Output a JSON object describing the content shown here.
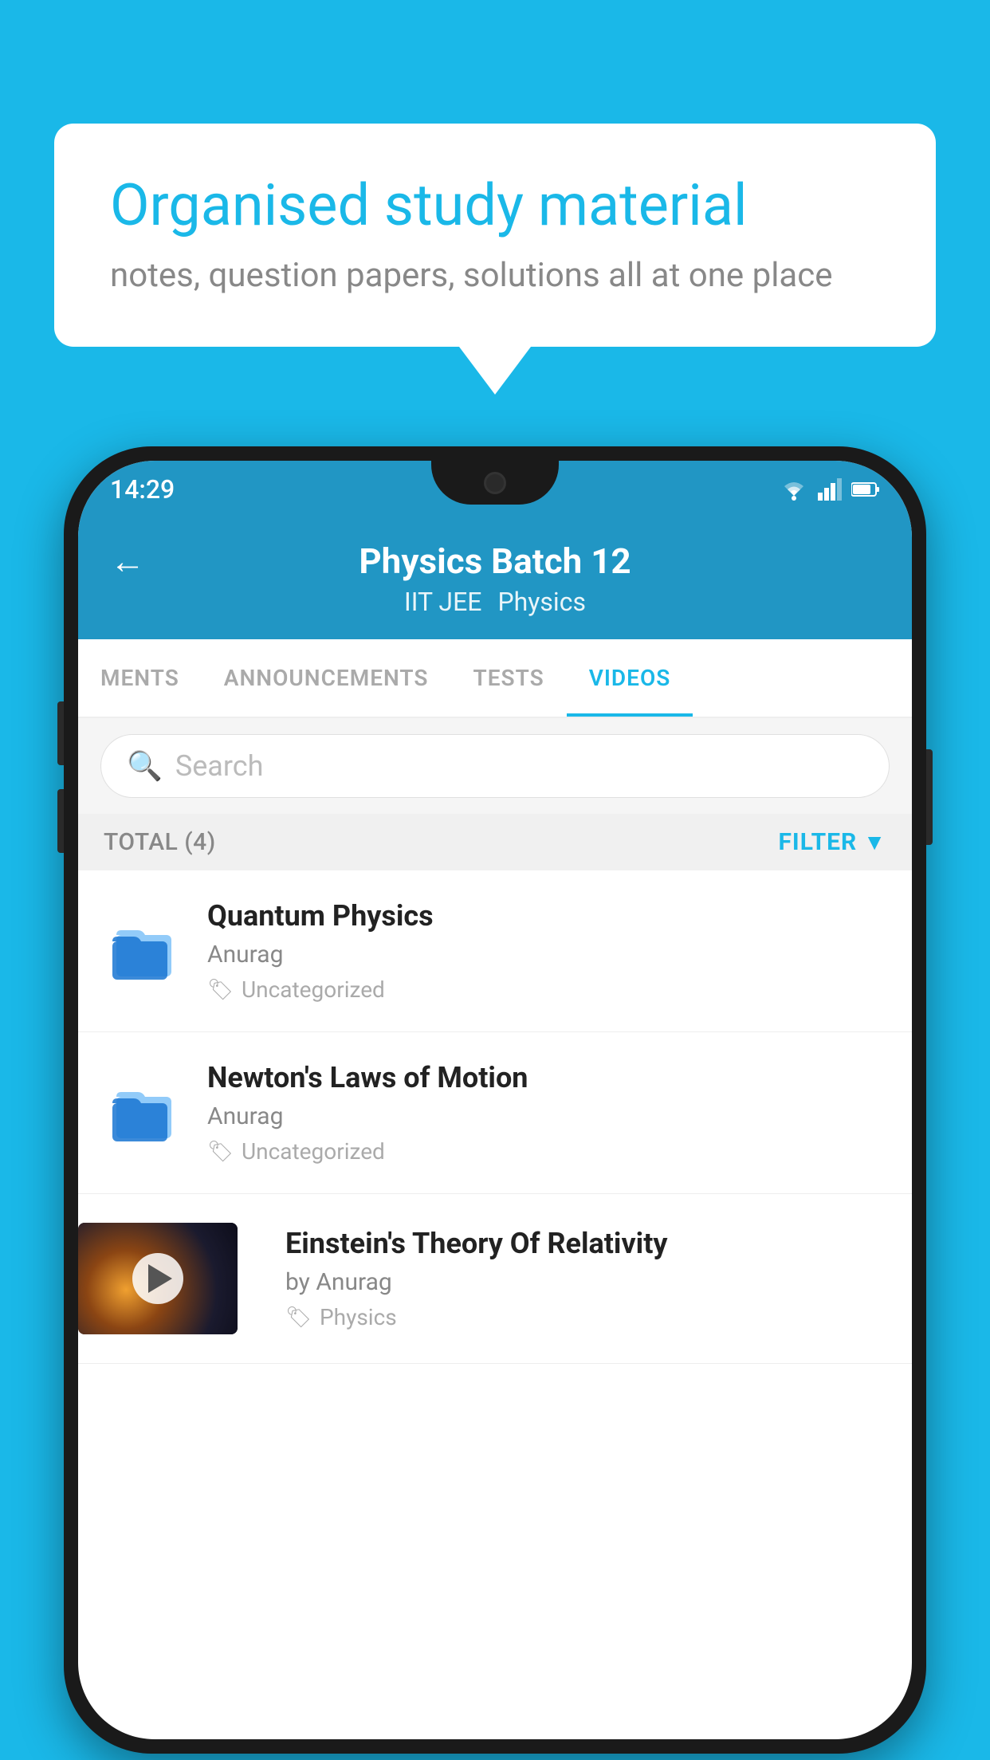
{
  "background_color": "#1ab8e8",
  "speech_bubble": {
    "title": "Organised study material",
    "subtitle": "notes, question papers, solutions all at one place"
  },
  "phone": {
    "status_bar": {
      "time": "14:29",
      "icons": [
        "wifi",
        "signal",
        "battery"
      ]
    },
    "header": {
      "back_label": "←",
      "title": "Physics Batch 12",
      "subtitle_parts": [
        "IIT JEE",
        "Physics"
      ]
    },
    "tabs": [
      {
        "label": "MENTS",
        "active": false
      },
      {
        "label": "ANNOUNCEMENTS",
        "active": false
      },
      {
        "label": "TESTS",
        "active": false
      },
      {
        "label": "VIDEOS",
        "active": true
      }
    ],
    "search": {
      "placeholder": "Search"
    },
    "filter_bar": {
      "total_label": "TOTAL (4)",
      "filter_label": "FILTER"
    },
    "videos": [
      {
        "id": 1,
        "title": "Quantum Physics",
        "author": "Anurag",
        "tag": "Uncategorized",
        "has_thumbnail": false
      },
      {
        "id": 2,
        "title": "Newton's Laws of Motion",
        "author": "Anurag",
        "tag": "Uncategorized",
        "has_thumbnail": false
      },
      {
        "id": 3,
        "title": "Einstein's Theory Of Relativity",
        "author": "by Anurag",
        "tag": "Physics",
        "has_thumbnail": true
      }
    ]
  }
}
